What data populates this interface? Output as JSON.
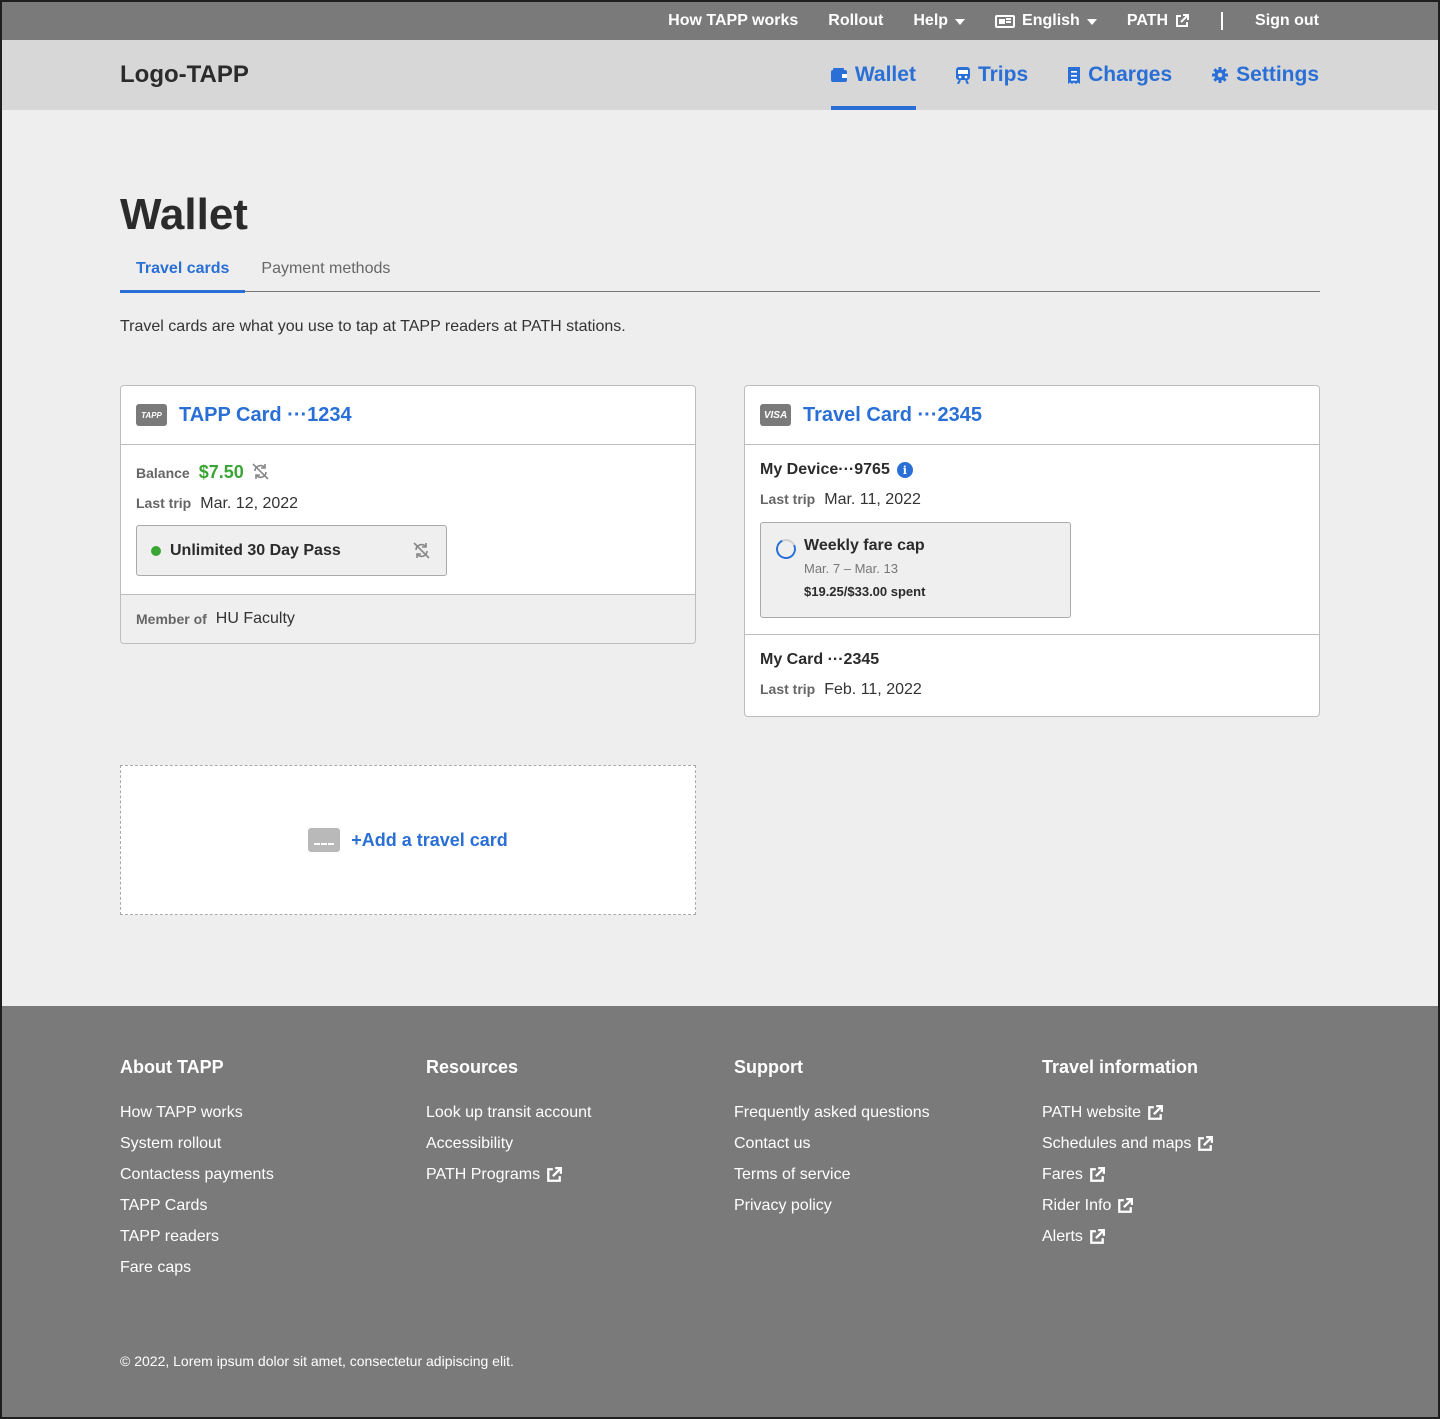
{
  "utility_nav": {
    "how_it_works": "How TAPP works",
    "rollout": "Rollout",
    "help": "Help",
    "language": "English",
    "path": "PATH",
    "sign_out": "Sign out"
  },
  "header": {
    "logo": "Logo-TAPP",
    "nav": [
      {
        "label": "Wallet",
        "icon": "wallet-icon",
        "active": true
      },
      {
        "label": "Trips",
        "icon": "train-icon",
        "active": false
      },
      {
        "label": "Charges",
        "icon": "receipt-icon",
        "active": false
      },
      {
        "label": "Settings",
        "icon": "gear-icon",
        "active": false
      }
    ]
  },
  "page": {
    "title": "Wallet",
    "tabs": [
      {
        "label": "Travel cards",
        "active": true
      },
      {
        "label": "Payment methods",
        "active": false
      }
    ],
    "intro": "Travel cards are what you use to tap at TAPP readers at PATH stations."
  },
  "tapp_card": {
    "logo_text": "TAPP",
    "title": "TAPP Card ···1234",
    "balance_label": "Balance",
    "balance_value": "$7.50",
    "last_trip_label": "Last trip",
    "last_trip_value": "Mar. 12, 2022",
    "pass_name": "Unlimited 30 Day Pass",
    "member_label": "Member of",
    "member_value": "HU Faculty"
  },
  "travel_card": {
    "logo_text": "VISA",
    "title": "Travel Card ···2345",
    "device": {
      "name": "My Device···9765",
      "last_trip_label": "Last trip",
      "last_trip_value": "Mar. 11, 2022",
      "fare_cap": {
        "title": "Weekly fare cap",
        "dates": "Mar. 7 – Mar. 13",
        "spent": "$19.25/$33.00 spent",
        "progress_fraction": 0.58
      }
    },
    "card": {
      "name": "My Card ···2345",
      "last_trip_label": "Last trip",
      "last_trip_value": "Feb. 11, 2022"
    }
  },
  "add_card": {
    "label": "+Add a travel card"
  },
  "footer": {
    "columns": [
      {
        "heading": "About TAPP",
        "links": [
          {
            "label": "How TAPP works",
            "external": false
          },
          {
            "label": "System rollout",
            "external": false
          },
          {
            "label": "Contactess payments",
            "external": false
          },
          {
            "label": "TAPP Cards",
            "external": false
          },
          {
            "label": "TAPP readers",
            "external": false
          },
          {
            "label": "Fare caps",
            "external": false
          }
        ]
      },
      {
        "heading": "Resources",
        "links": [
          {
            "label": "Look up transit account",
            "external": false
          },
          {
            "label": "Accessibility",
            "external": false
          },
          {
            "label": "PATH Programs",
            "external": true
          }
        ]
      },
      {
        "heading": "Support",
        "links": [
          {
            "label": "Frequently asked questions",
            "external": false
          },
          {
            "label": "Contact us",
            "external": false
          },
          {
            "label": "Terms of service",
            "external": false
          },
          {
            "label": "Privacy policy",
            "external": false
          }
        ]
      },
      {
        "heading": "Travel information",
        "links": [
          {
            "label": "PATH website",
            "external": true
          },
          {
            "label": "Schedules and maps",
            "external": true
          },
          {
            "label": "Fares",
            "external": true
          },
          {
            "label": "Rider Info",
            "external": true
          },
          {
            "label": "Alerts",
            "external": true
          }
        ]
      }
    ],
    "copyright": "© 2022, Lorem ipsum dolor sit amet, consectetur adipiscing elit."
  },
  "colors": {
    "accent": "#2a6fd6",
    "balance_green": "#3aa535",
    "utility_bar": "#7a7a7a",
    "header_bg": "#d7d7d7",
    "page_bg": "#eeeeee"
  }
}
